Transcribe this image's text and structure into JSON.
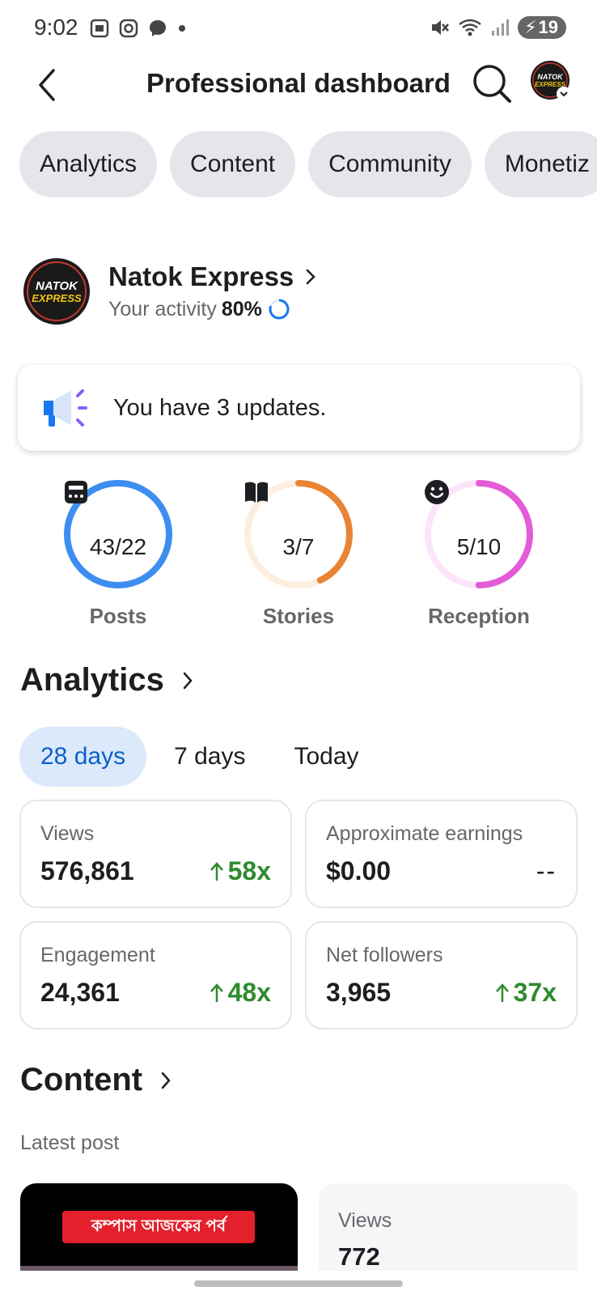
{
  "status_bar": {
    "time": "9:02",
    "battery": "19"
  },
  "header": {
    "title": "Professional dashboard"
  },
  "tabs": [
    "Analytics",
    "Content",
    "Community",
    "Monetiz"
  ],
  "profile": {
    "name": "Natok Express",
    "activity_label": "Your activity",
    "activity_value": "80%",
    "avatar_text": "NATOK EXPRESS"
  },
  "updates": {
    "text": "You have 3 updates."
  },
  "rings": [
    {
      "value": "43/22",
      "label": "Posts",
      "progress": 1.0,
      "color": "#3d8ef0",
      "track": "#dbe9fb",
      "icon": "post-icon"
    },
    {
      "value": "3/7",
      "label": "Stories",
      "progress": 0.43,
      "color": "#e98434",
      "track": "#fdeee0",
      "icon": "book-icon"
    },
    {
      "value": "5/10",
      "label": "Reception",
      "progress": 0.5,
      "color": "#e45bd7",
      "track": "#fce4fa",
      "icon": "smiley-icon"
    }
  ],
  "analytics": {
    "heading": "Analytics",
    "ranges": [
      "28 days",
      "7 days",
      "Today"
    ],
    "stats": [
      {
        "label": "Views",
        "value": "576,861",
        "change": "58x"
      },
      {
        "label": "Approximate earnings",
        "value": "$0.00",
        "change": "--"
      },
      {
        "label": "Engagement",
        "value": "24,361",
        "change": "48x"
      },
      {
        "label": "Net followers",
        "value": "3,965",
        "change": "37x"
      }
    ]
  },
  "content": {
    "heading": "Content",
    "latest_label": "Latest post",
    "post_banner": "কম্পাস আজকের পর্ব",
    "views_label": "Views",
    "views_value": "772"
  },
  "colors": {
    "accent": "#0b5fc9",
    "positive": "#2e8b2e",
    "chip_bg": "#e4e6eb"
  }
}
